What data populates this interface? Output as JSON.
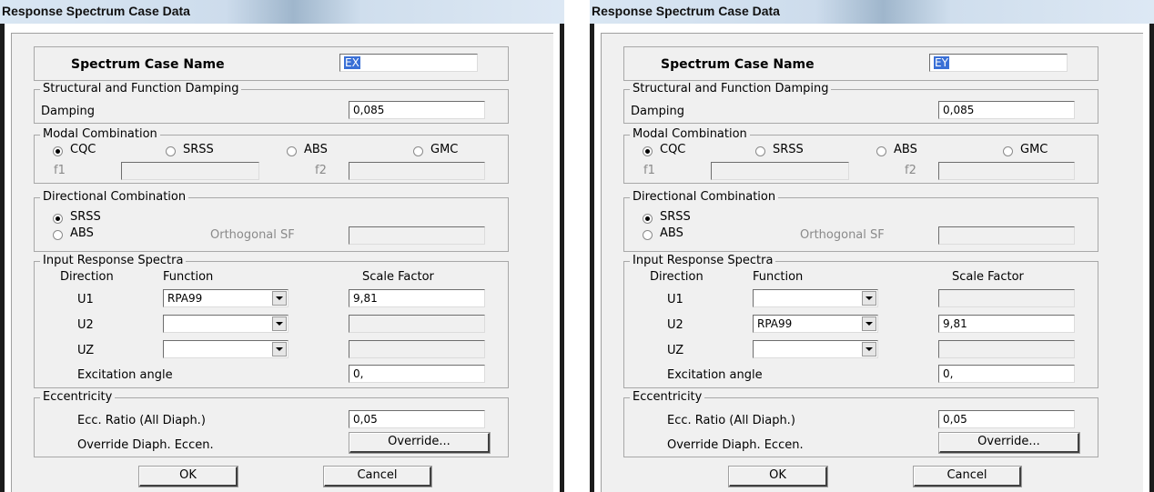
{
  "dialogs": [
    {
      "title": "Response Spectrum Case Data",
      "case_name_label": "Spectrum Case Name",
      "case_name_value": "EX",
      "damping_group": "Structural and Function Damping",
      "damping_label": "Damping",
      "damping_value": "0,085",
      "modal_group": "Modal Combination",
      "modal_options": [
        "CQC",
        "SRSS",
        "ABS",
        "GMC"
      ],
      "modal_selected": "CQC",
      "f1_label": "f1",
      "f2_label": "f2",
      "directional_group": "Directional Combination",
      "dir_options": [
        "SRSS",
        "ABS"
      ],
      "dir_selected": "SRSS",
      "orthogonal_label": "Orthogonal SF",
      "input_group": "Input Response Spectra",
      "col_direction": "Direction",
      "col_function": "Function",
      "col_scale": "Scale Factor",
      "rows": [
        {
          "dir": "U1",
          "function": "RPA99",
          "scale": "9,81"
        },
        {
          "dir": "U2",
          "function": "",
          "scale": ""
        },
        {
          "dir": "UZ",
          "function": "",
          "scale": ""
        }
      ],
      "excitation_label": "Excitation angle",
      "excitation_value": "0,",
      "ecc_group": "Eccentricity",
      "ecc_ratio_label": "Ecc. Ratio (All Diaph.)",
      "ecc_ratio_value": "0,05",
      "override_label": "Override Diaph. Eccen.",
      "override_button": "Override...",
      "ok_button": "OK",
      "cancel_button": "Cancel"
    },
    {
      "title": "Response Spectrum Case Data",
      "case_name_label": "Spectrum Case Name",
      "case_name_value": "EY",
      "damping_group": "Structural and Function Damping",
      "damping_label": "Damping",
      "damping_value": "0,085",
      "modal_group": "Modal Combination",
      "modal_options": [
        "CQC",
        "SRSS",
        "ABS",
        "GMC"
      ],
      "modal_selected": "CQC",
      "f1_label": "f1",
      "f2_label": "f2",
      "directional_group": "Directional Combination",
      "dir_options": [
        "SRSS",
        "ABS"
      ],
      "dir_selected": "SRSS",
      "orthogonal_label": "Orthogonal SF",
      "input_group": "Input Response Spectra",
      "col_direction": "Direction",
      "col_function": "Function",
      "col_scale": "Scale Factor",
      "rows": [
        {
          "dir": "U1",
          "function": "",
          "scale": ""
        },
        {
          "dir": "U2",
          "function": "RPA99",
          "scale": "9,81"
        },
        {
          "dir": "UZ",
          "function": "",
          "scale": ""
        }
      ],
      "excitation_label": "Excitation angle",
      "excitation_value": "0,",
      "ecc_group": "Eccentricity",
      "ecc_ratio_label": "Ecc. Ratio (All Diaph.)",
      "ecc_ratio_value": "0,05",
      "override_label": "Override Diaph. Eccen.",
      "override_button": "Override...",
      "ok_button": "OK",
      "cancel_button": "Cancel"
    }
  ]
}
